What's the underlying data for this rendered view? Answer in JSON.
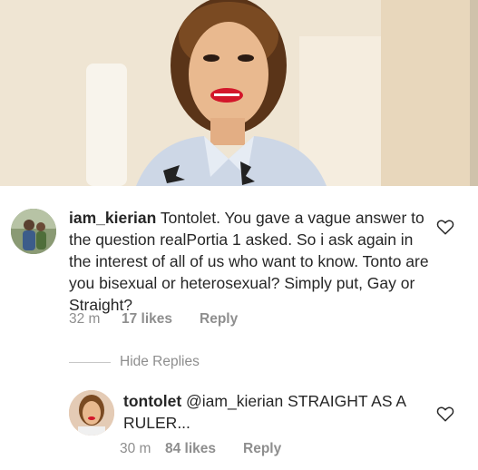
{
  "photo": {
    "alt": ""
  },
  "comments": [
    {
      "username": "iam_kierian",
      "text": " Tontolet. You gave a vague answer to the question realPortia 1 asked. So i ask again in the interest of all of us who want to know. Tonto are you bisexual or heterosexual? Simply put, Gay or Straight?",
      "time": "32 m",
      "likes": "17 likes",
      "reply": "Reply"
    }
  ],
  "hide_replies": "Hide Replies",
  "replies": [
    {
      "username": "tontolet",
      "text": " @iam_kierian STRAIGHT AS A RULER...",
      "time": "30 m",
      "likes": "84 likes",
      "reply": "Reply"
    }
  ],
  "icons": {
    "like": "heart-outline-icon"
  },
  "colors": {
    "text": "#262626",
    "meta": "#8e8e8e",
    "divider": "#c7c7c7"
  }
}
